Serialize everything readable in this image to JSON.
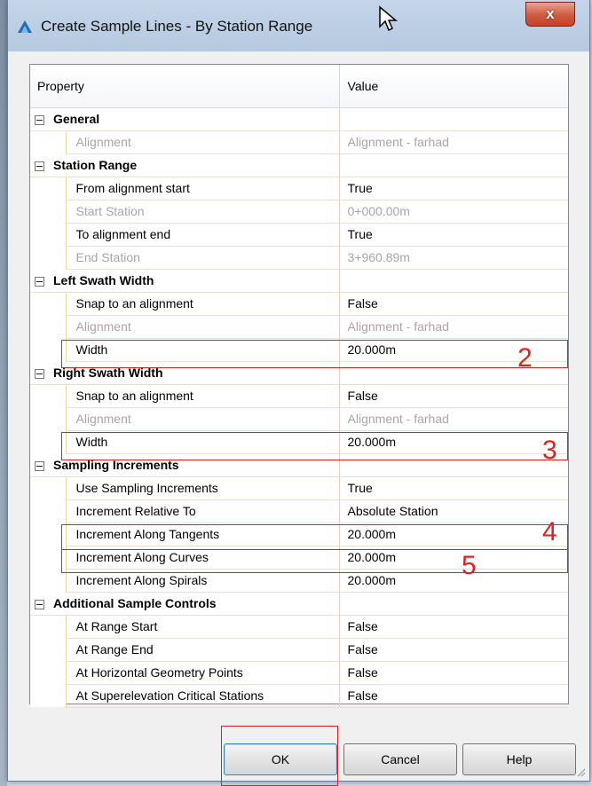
{
  "window": {
    "title": "Create Sample Lines - By Station Range",
    "close_glyph": "x",
    "app_icon": "autocad-a-icon"
  },
  "grid": {
    "header_property": "Property",
    "header_value": "Value"
  },
  "categories": [
    {
      "label": "General",
      "rows": [
        {
          "name": "Alignment",
          "value": "Alignment - farhad",
          "disabled": true
        }
      ]
    },
    {
      "label": "Station Range",
      "rows": [
        {
          "name": "From alignment start",
          "value": "True",
          "disabled": false
        },
        {
          "name": "Start Station",
          "value": "0+000.00m",
          "disabled": true
        },
        {
          "name": "To alignment end",
          "value": "True",
          "disabled": false
        },
        {
          "name": "End Station",
          "value": "3+960.89m",
          "disabled": true
        }
      ]
    },
    {
      "label": "Left Swath Width",
      "rows": [
        {
          "name": "Snap to an alignment",
          "value": "False",
          "disabled": false
        },
        {
          "name": "Alignment",
          "value": "Alignment - farhad",
          "disabled": true
        },
        {
          "name": "Width",
          "value": "20.000m",
          "disabled": false
        }
      ]
    },
    {
      "label": "Right Swath Width",
      "rows": [
        {
          "name": "Snap to an alignment",
          "value": "False",
          "disabled": false
        },
        {
          "name": "Alignment",
          "value": "Alignment - farhad",
          "disabled": true
        },
        {
          "name": "Width",
          "value": "20.000m",
          "disabled": false
        }
      ]
    },
    {
      "label": "Sampling Increments",
      "rows": [
        {
          "name": "Use Sampling Increments",
          "value": "True",
          "disabled": false
        },
        {
          "name": "Increment Relative To",
          "value": "Absolute Station",
          "disabled": false
        },
        {
          "name": "Increment Along Tangents",
          "value": "20.000m",
          "disabled": false
        },
        {
          "name": "Increment Along Curves",
          "value": "20.000m",
          "disabled": false
        },
        {
          "name": "Increment Along Spirals",
          "value": "20.000m",
          "disabled": false
        }
      ]
    },
    {
      "label": "Additional Sample Controls",
      "rows": [
        {
          "name": "At Range Start",
          "value": "False",
          "disabled": false
        },
        {
          "name": "At Range End",
          "value": "False",
          "disabled": false
        },
        {
          "name": "At Horizontal Geometry Points",
          "value": "False",
          "disabled": false
        },
        {
          "name": "At Superelevation Critical Stations",
          "value": "False",
          "disabled": false
        }
      ]
    }
  ],
  "annotations": [
    "2",
    "3",
    "4",
    "5"
  ],
  "buttons": {
    "ok": "OK",
    "cancel": "Cancel",
    "help": "Help"
  },
  "colors": {
    "annotation": "#e02020",
    "title_bar": "#b5c9df",
    "close_button": "#cf5a3e"
  }
}
